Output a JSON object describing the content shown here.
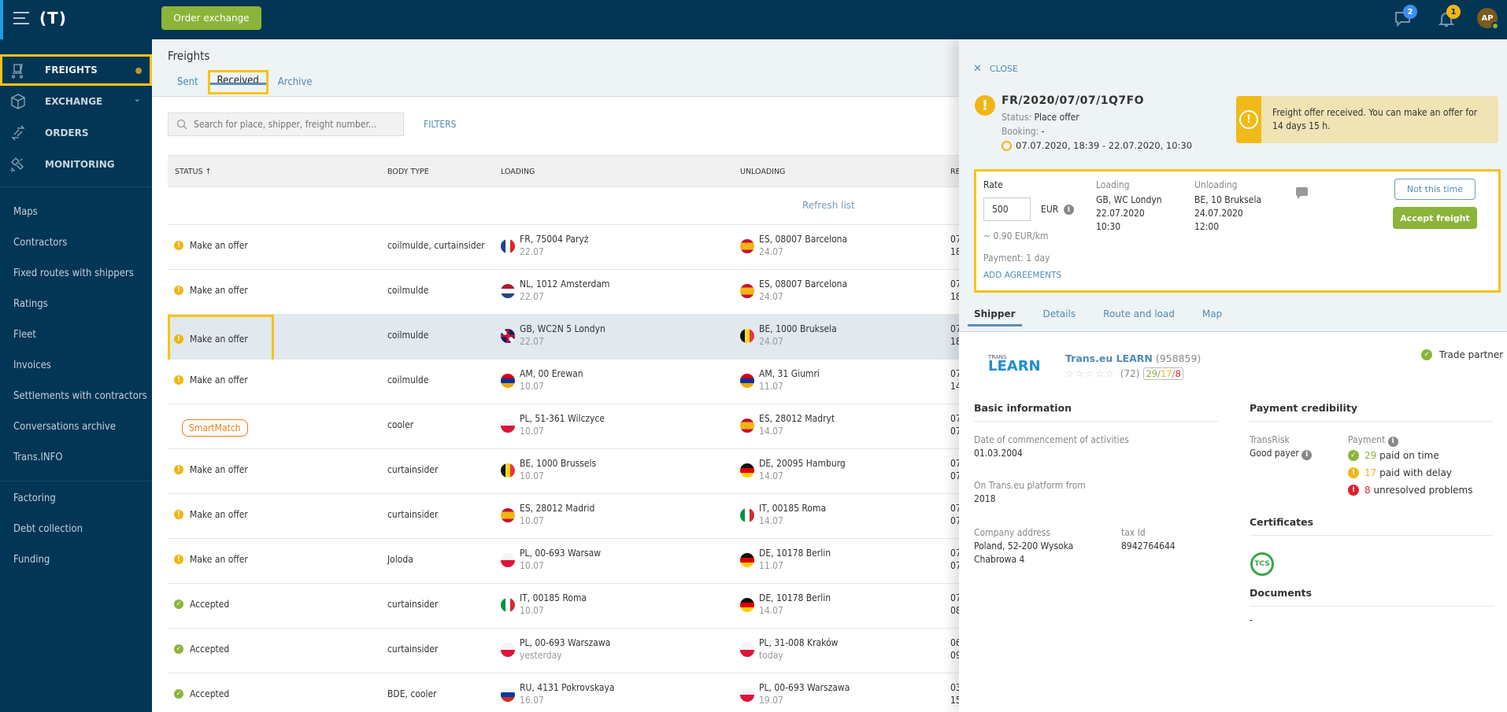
{
  "topbar": {
    "logo": "(T)",
    "order_exchange_label": "Order exchange",
    "messages_count": "2",
    "notifications_count": "1",
    "avatar_initials": "AP"
  },
  "sidebar": {
    "main_items": [
      {
        "label": "FREIGHTS",
        "icon": "freight-cart-icon",
        "active": true,
        "has_dot": true
      },
      {
        "label": "EXCHANGE",
        "icon": "cube-icon",
        "expandable": true
      },
      {
        "label": "ORDERS",
        "icon": "orders-arrows-icon"
      },
      {
        "label": "MONITORING",
        "icon": "satellite-icon"
      }
    ],
    "links": [
      "Maps",
      "Contractors",
      "Fixed routes with shippers",
      "Ratings",
      "Fleet",
      "Invoices",
      "Settlements with contractors",
      "Conversations archive",
      "Trans.INFO"
    ],
    "finance_links": [
      "Factoring",
      "Debt collection",
      "Funding"
    ]
  },
  "main": {
    "title": "Freights",
    "tabs": [
      {
        "label": "Sent"
      },
      {
        "label": "Received",
        "active": true
      },
      {
        "label": "Archive"
      }
    ],
    "search_placeholder": "Search for place, shipper, freight number...",
    "filters_label": "FILTERS",
    "refresh_label": "Refresh list",
    "columns": [
      "STATUS ↑",
      "BODY TYPE",
      "LOADING",
      "UNLOADING",
      "RE"
    ],
    "rows": [
      {
        "status": "Make an offer",
        "status_type": "warn",
        "body": "coilmulde, curtainsider",
        "load_flag": "fr",
        "load_place": "FR, 75004 Paryż",
        "load_date": "22.07",
        "unload_flag": "es",
        "unload_place": "ES, 08007 Barcelona",
        "unload_date": "24.07",
        "rest1": "07",
        "rest2": "18"
      },
      {
        "status": "Make an offer",
        "status_type": "warn",
        "body": "coilmulde",
        "load_flag": "nl",
        "load_place": "NL, 1012 Amsterdam",
        "load_date": "22.07",
        "unload_flag": "es",
        "unload_place": "ES, 08007 Barcelona",
        "unload_date": "24.07",
        "rest1": "07",
        "rest2": "18"
      },
      {
        "status": "Make an offer",
        "status_type": "warn",
        "selected": true,
        "body": "coilmulde",
        "load_flag": "gb",
        "load_place": "GB, WC2N 5 Londyn",
        "load_date": "22.07",
        "unload_flag": "be",
        "unload_place": "BE, 1000 Bruksela",
        "unload_date": "24.07",
        "rest1": "07",
        "rest2": "18"
      },
      {
        "status": "Make an offer",
        "status_type": "warn",
        "body": "coilmulde",
        "load_flag": "am",
        "load_place": "AM, 00 Erewan",
        "load_date": "10.07",
        "unload_flag": "am",
        "unload_place": "AM, 31 Giumri",
        "unload_date": "11.07",
        "rest1": "07",
        "rest2": "14"
      },
      {
        "status": "SmartMatch",
        "status_type": "smartmatch",
        "body": "cooler",
        "load_flag": "pl",
        "load_place": "PL, 51-361 Wilczyce",
        "load_date": "10.07",
        "unload_flag": "es",
        "unload_place": "ES, 28012 Madryt",
        "unload_date": "14.07",
        "rest1": "07",
        "rest2": "07"
      },
      {
        "status": "Make an offer",
        "status_type": "warn",
        "body": "curtainsider",
        "load_flag": "be",
        "load_place": "BE, 1000 Brussels",
        "load_date": "10.07",
        "unload_flag": "de",
        "unload_place": "DE, 20095 Hamburg",
        "unload_date": "14.07",
        "rest1": "07",
        "rest2": "07"
      },
      {
        "status": "Make an offer",
        "status_type": "warn",
        "body": "curtainsider",
        "load_flag": "es",
        "load_place": "ES, 28012 Madrid",
        "load_date": "10.07",
        "unload_flag": "it",
        "unload_place": "IT, 00185 Roma",
        "unload_date": "14.07",
        "rest1": "07",
        "rest2": "07"
      },
      {
        "status": "Make an offer",
        "status_type": "warn",
        "body": "Joloda",
        "load_flag": "pl",
        "load_place": "PL, 00-693 Warsaw",
        "load_date": "10.07",
        "unload_flag": "de",
        "unload_place": "DE, 10178 Berlin",
        "unload_date": "11.07",
        "rest1": "07",
        "rest2": "07"
      },
      {
        "status": "Accepted",
        "status_type": "ok",
        "body": "curtainsider",
        "load_flag": "it",
        "load_place": "IT, 00185 Roma",
        "load_date": "10.07",
        "unload_flag": "de",
        "unload_place": "DE, 10178 Berlin",
        "unload_date": "14.07",
        "rest1": "07",
        "rest2": "08"
      },
      {
        "status": "Accepted",
        "status_type": "ok",
        "body": "curtainsider",
        "load_flag": "pl",
        "load_place": "PL, 00-693 Warszawa",
        "load_date": "yesterday",
        "unload_flag": "pl",
        "unload_place": "PL, 31-008 Kraków",
        "unload_date": "today",
        "rest1": "06",
        "rest2": "09"
      },
      {
        "status": "Accepted",
        "status_type": "ok",
        "body": "BDE, cooler",
        "load_flag": "ru",
        "load_place": "RU, 4131 Pokrovskaya",
        "load_date": "16.07",
        "unload_flag": "pl",
        "unload_place": "PL, 00-693 Warszawa",
        "unload_date": "19.07",
        "rest1": "03",
        "rest2": "15"
      }
    ]
  },
  "panel": {
    "close_label": "CLOSE",
    "freight_number": "FR/2020/07/07/1Q7FO",
    "status_label": "Status:",
    "status_value": "Place offer",
    "booking_label": "Booking:",
    "booking_value": "-",
    "date_range": "07.07.2020, 18:39 - 22.07.2020, 10:30",
    "notice": "Freight offer received. You can make an offer for 14 days 15 h.",
    "offer": {
      "rate_label": "Rate",
      "rate_value": "500",
      "currency": "EUR",
      "per_km": "~ 0.90  EUR/km",
      "payment": "Payment:  1 day",
      "loading_label": "Loading",
      "loading_place": "GB, WC Londyn",
      "loading_date": "22.07.2020",
      "loading_time": "10:30",
      "unloading_label": "Unloading",
      "unloading_place": "BE, 10 Bruksela",
      "unloading_date": "24.07.2020",
      "unloading_time": "12:00",
      "not_this_time": "Not this time",
      "accept": "Accept freight",
      "add_agreements": "ADD AGREEMENTS"
    },
    "tabs": [
      "Shipper",
      "Details",
      "Route and load",
      "Map"
    ],
    "shipper": {
      "logo_top": "TRANS",
      "logo_main": "LEARN",
      "name": "Trans.eu LEARN",
      "id": "(958859)",
      "stars": "☆☆☆☆☆",
      "rating_count": "(72)",
      "score_good": "29",
      "score_mid": "17",
      "score_bad": "8",
      "trade_partner": "Trade partner",
      "basic_info_title": "Basic information",
      "commencement_label": "Date of commencement of activities",
      "commencement_value": "01.03.2004",
      "platform_label": "On Trans.eu platform from",
      "platform_value": "2018",
      "address_label": "Company address",
      "address_line1": "Poland, 52-200 Wysoka",
      "address_line2": "Chabrowa 4",
      "tax_label": "tax Id",
      "tax_value": "8942764644",
      "payment_title": "Payment credibility",
      "transrisk_label": "TransRisk",
      "transrisk_value": "Good payer",
      "payment_label": "Payment",
      "paid_on_time_count": "29",
      "paid_on_time_label": "paid on time",
      "paid_delay_count": "17",
      "paid_delay_label": "paid with delay",
      "unresolved_count": "8",
      "unresolved_label": "unresolved problems",
      "certificates_title": "Certificates",
      "certificate": "TCS",
      "documents_title": "Documents",
      "documents_value": "-"
    }
  },
  "colors": {
    "navy": "#033554",
    "accent_green": "#8cb43a",
    "link_blue": "#4e8bb3",
    "highlight_yellow": "#f6c416",
    "warn_yellow": "#f2b514",
    "error_red": "#e0222e",
    "smartmatch_orange": "#f07a1a"
  }
}
